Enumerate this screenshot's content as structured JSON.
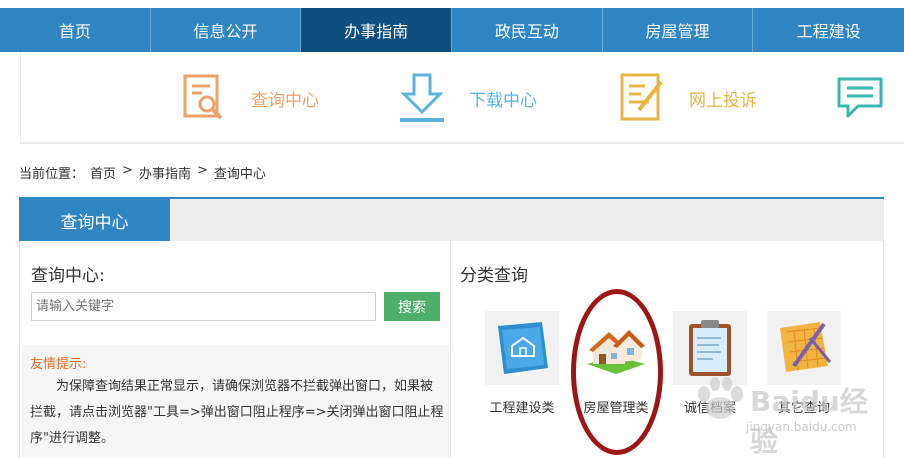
{
  "nav": {
    "items": [
      {
        "label": "首页",
        "active": false
      },
      {
        "label": "信息公开",
        "active": false
      },
      {
        "label": "办事指南",
        "active": true
      },
      {
        "label": "政民互动",
        "active": false
      },
      {
        "label": "房屋管理",
        "active": false
      },
      {
        "label": "工程建设",
        "active": false
      }
    ]
  },
  "quick_links": [
    {
      "label": "查询中心",
      "icon": "search-document-icon",
      "color": "#f0a06a"
    },
    {
      "label": "下载中心",
      "icon": "download-icon",
      "color": "#5bb3d8"
    },
    {
      "label": "网上投诉",
      "icon": "complaint-form-icon",
      "color": "#e5b646"
    },
    {
      "label": "",
      "icon": "message-icon",
      "color": "#3ab8b0"
    }
  ],
  "breadcrumb": {
    "prefix": "当前位置：",
    "items": [
      "首页",
      "办事指南",
      "查询中心"
    ],
    "separator": ">"
  },
  "panel": {
    "tab": "查询中心",
    "search": {
      "title": "查询中心:",
      "placeholder": "请输入关键字",
      "button": "搜索"
    },
    "tip": {
      "title": "友情提示:",
      "body": "为保障查询结果正常显示，请确保浏览器不拦截弹出窗口，如果被拦截，请点击浏览器\"工具=>弹出窗口阻止程序=>关闭弹出窗口阻止程序\"进行调整。"
    },
    "category": {
      "title": "分类查询",
      "items": [
        {
          "label": "工程建设类",
          "icon": "blueprint-house-icon"
        },
        {
          "label": "房屋管理类",
          "icon": "house-icon"
        },
        {
          "label": "诚信档案",
          "icon": "clipboard-icon"
        },
        {
          "label": "其它查询",
          "icon": "drafting-tools-icon"
        }
      ]
    }
  },
  "watermark": {
    "text": "Baidu经验",
    "sub": "jingyan.baidu.com"
  },
  "colors": {
    "nav_bg": "#2f86c2",
    "nav_active": "#0f4f80",
    "search_button": "#4cae6a",
    "tip_title": "#e56d21",
    "highlight_ring": "#9b1519"
  }
}
